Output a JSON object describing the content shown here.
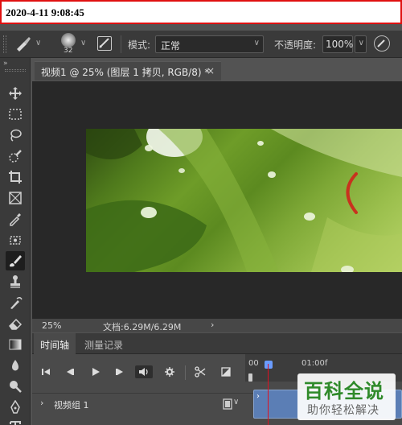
{
  "timestamp": "2020-4-11 9:08:45",
  "options": {
    "brush_size": "32",
    "mode_label": "模式:",
    "mode_value": "正常",
    "opacity_label": "不透明度:",
    "opacity_value": "100%"
  },
  "document": {
    "tab_title": "视频1 @ 25% (图层 1 拷贝, RGB/8) *",
    "close_glyph": "×",
    "zoom": "25%",
    "doc_info": "文档:6.29M/6.29M"
  },
  "timeline": {
    "tabs": [
      "时间轴",
      "测量记录"
    ],
    "ruler_start": "00",
    "ruler_mark": "01:00f",
    "track_name": "视频组 1"
  },
  "watermark": {
    "title": "百科全说",
    "subtitle": "助你轻松解决"
  },
  "tools": [
    "move-icon",
    "marquee-icon",
    "lasso-icon",
    "quick-select-icon",
    "crop-icon",
    "frame-icon",
    "eyedropper-icon",
    "patch-icon",
    "brush-icon",
    "stamp-icon",
    "history-brush-icon",
    "eraser-icon",
    "gradient-icon",
    "blur-icon",
    "dodge-icon",
    "pen-icon",
    "type-icon"
  ],
  "colors": {
    "accent": "#6a9cff",
    "playhead": "#dd1122",
    "clip": "#5b7eb5",
    "watermark_green": "#2f8a2a",
    "timestamp_border": "#e01010"
  }
}
